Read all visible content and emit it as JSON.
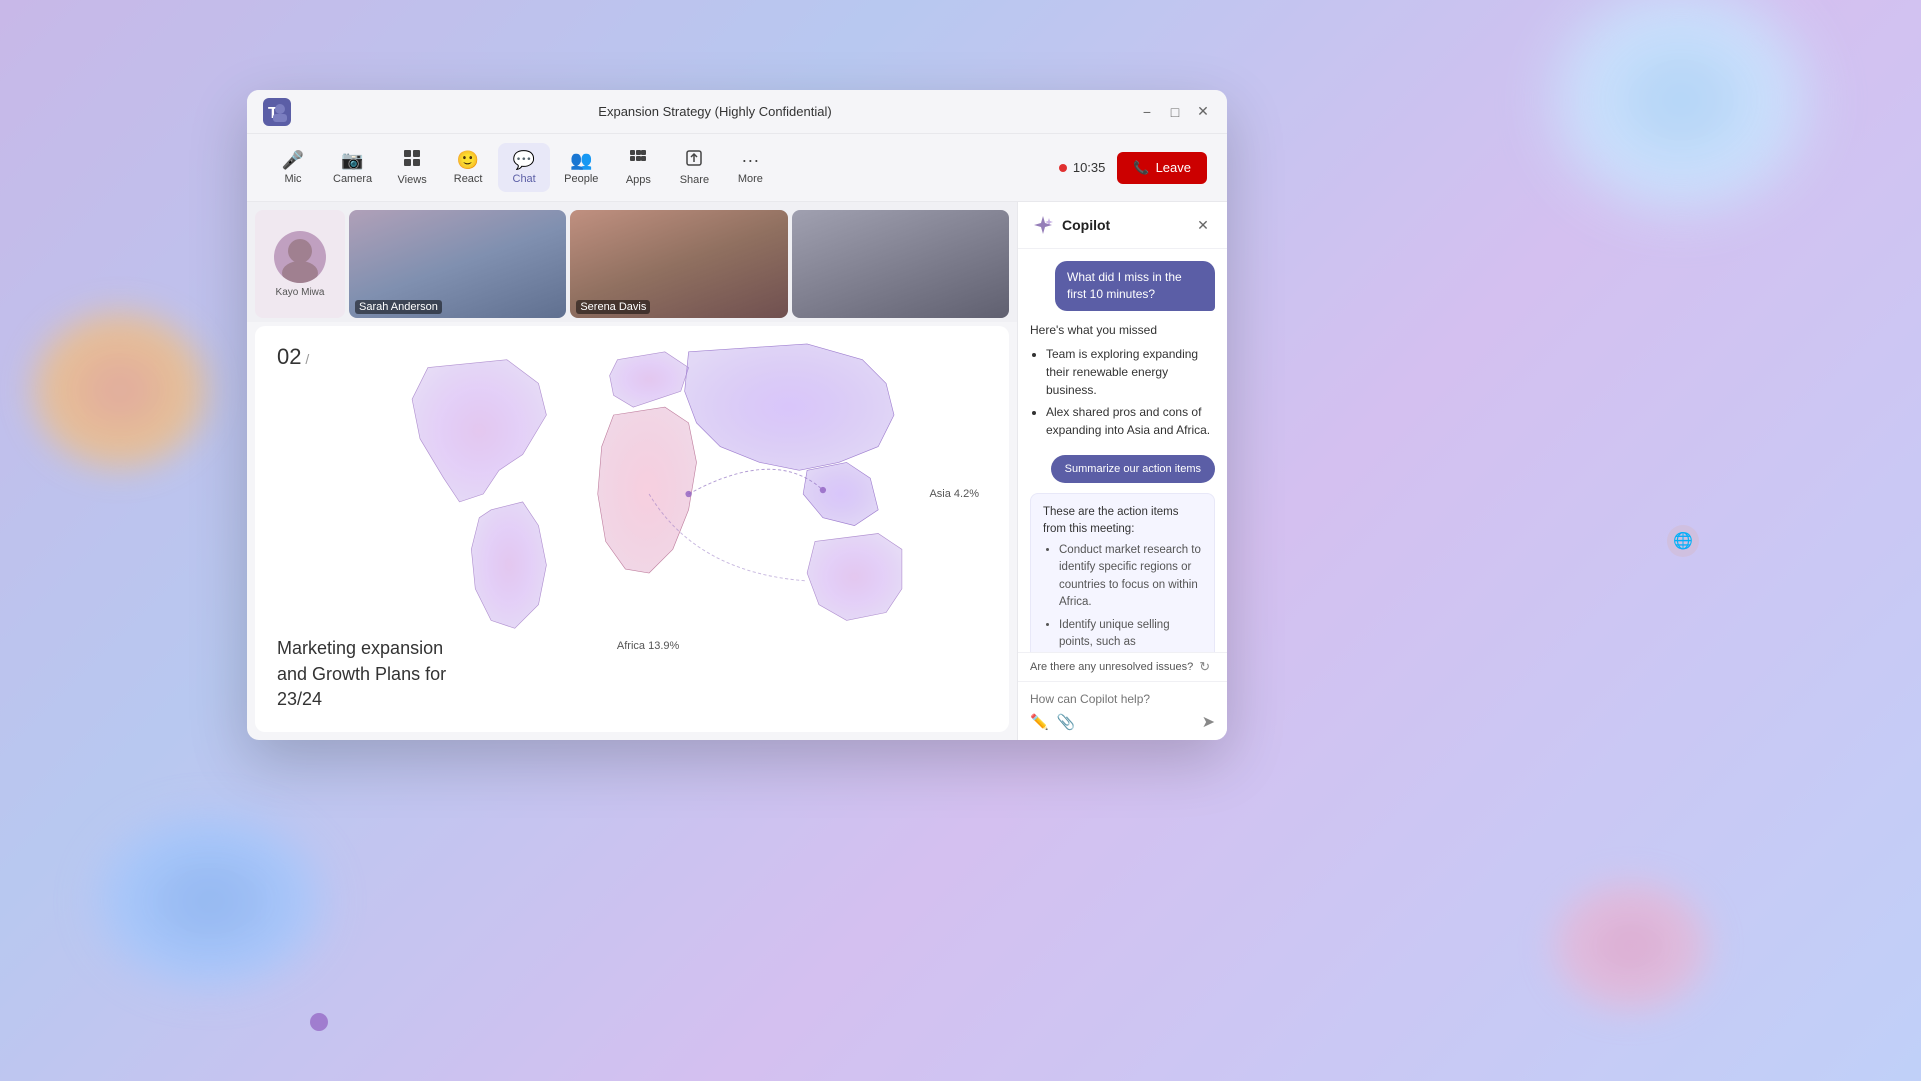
{
  "background": {
    "color": "#c8b8e8"
  },
  "window": {
    "title": "Expansion Strategy (Highly Confidential)"
  },
  "titlebar": {
    "title": "Expansion Strategy (Highly Confidential)",
    "minimize_label": "−",
    "maximize_label": "□",
    "close_label": "✕"
  },
  "toolbar": {
    "items": [
      {
        "id": "mic",
        "label": "Mic",
        "icon": "🎤",
        "active": false,
        "has_arrow": true
      },
      {
        "id": "camera",
        "label": "Camera",
        "icon": "📷",
        "active": false,
        "has_arrow": true
      },
      {
        "id": "views",
        "label": "Views",
        "icon": "⊞",
        "active": false
      },
      {
        "id": "react",
        "label": "React",
        "icon": "☺",
        "active": false
      },
      {
        "id": "chat",
        "label": "Chat",
        "icon": "💬",
        "active": true
      },
      {
        "id": "people",
        "label": "People",
        "icon": "👥",
        "active": false
      },
      {
        "id": "apps",
        "label": "Apps",
        "icon": "⊞",
        "active": false
      },
      {
        "id": "share",
        "label": "Share",
        "icon": "↑",
        "active": false
      },
      {
        "id": "more",
        "label": "More",
        "icon": "···",
        "active": false
      }
    ],
    "time": "10:35",
    "leave_label": "Leave"
  },
  "participants": [
    {
      "name": "Kayo Miwa",
      "type": "local"
    },
    {
      "name": "Sarah Anderson",
      "type": "remote"
    },
    {
      "name": "Serena Davis",
      "type": "remote"
    },
    {
      "name": "",
      "type": "remote"
    }
  ],
  "presentation": {
    "slide_number": "02",
    "caption_line1": "Marketing expansion",
    "caption_line2": "and Growth Plans for",
    "caption_line3": "23/24",
    "asia_label": "Asia 4.2%",
    "africa_label": "Africa 13.9%"
  },
  "copilot": {
    "title": "Copilot",
    "close_label": "✕",
    "user_question": "What did I miss in the first 10 minutes?",
    "response_intro": "Here's what you missed",
    "response_bullets": [
      "Team is exploring expanding their renewable energy business.",
      "Alex shared pros and cons of expanding into Asia and Africa."
    ],
    "action_btn_label": "Summarize our action items",
    "action_response_intro": "These are the action items from this meeting:",
    "action_bullets": [
      "Conduct market research to identify specific regions or countries to focus on within Africa.",
      "Identify unique selling points, such as emphasizing the environmental benefits, could be effective in these regions."
    ],
    "unresolved_label": "Are there any unresolved issues?",
    "input_placeholder": "How can Copilot help?"
  }
}
